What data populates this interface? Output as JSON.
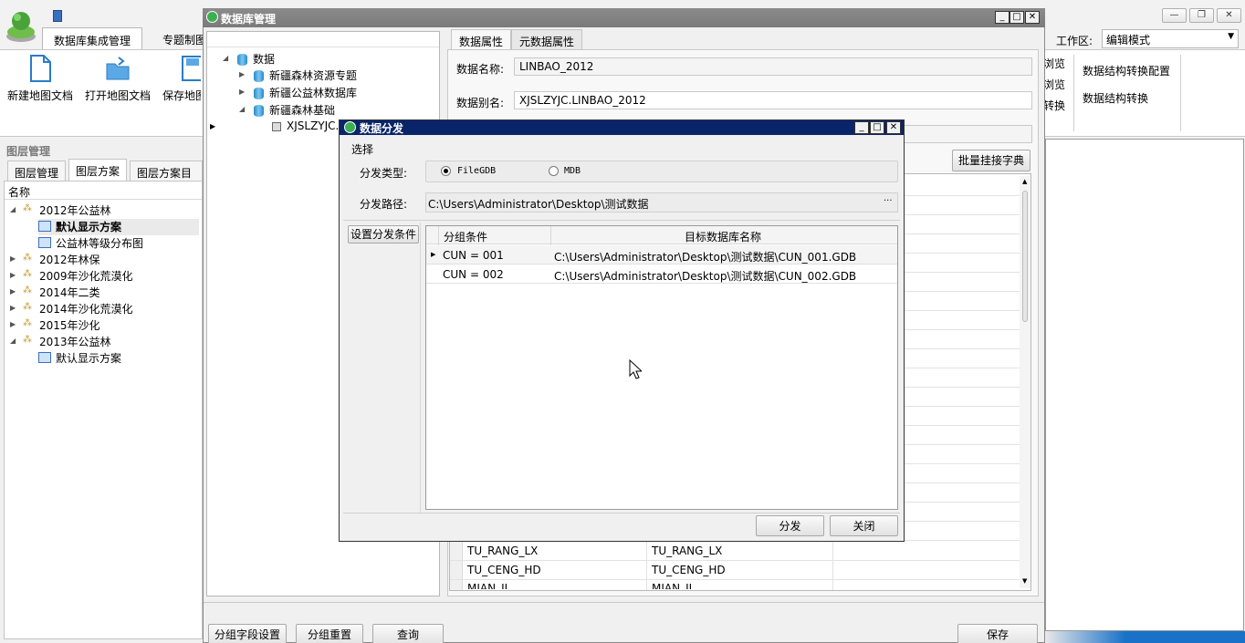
{
  "ribbon": {
    "tabs": [
      "数据库集成管理",
      "专题制图"
    ],
    "buttons": [
      "新建地图文档",
      "打开地图文档",
      "保存地图"
    ],
    "workspace_label": "工作区:",
    "workspace_value": "编辑模式",
    "right_small": [
      "浏览",
      "浏览",
      "转换"
    ],
    "right_buttons": [
      "数据结构转换配置",
      "数据结构转换"
    ]
  },
  "layer_panel": {
    "title": "图层管理",
    "tabs": [
      "图层管理",
      "图层方案",
      "图层方案目录"
    ],
    "column": "名称",
    "items": [
      {
        "label": "2012年公益林",
        "expanded": true,
        "children": [
          "默认显示方案",
          "公益林等级分布图"
        ]
      },
      {
        "label": "2012年林保"
      },
      {
        "label": "2009年沙化荒漠化"
      },
      {
        "label": "2014年二类"
      },
      {
        "label": "2014年沙化荒漠化"
      },
      {
        "label": "2015年沙化"
      },
      {
        "label": "2013年公益林",
        "expanded": true,
        "children": [
          "默认显示方案"
        ]
      }
    ]
  },
  "db_window": {
    "title": "数据库管理",
    "tree": {
      "root": "数据",
      "children": [
        "新疆森林资源专题",
        "新疆公益林数据库",
        "新疆森林基础"
      ],
      "leaf": "XJSLZYJC."
    },
    "tabs": [
      "数据属性",
      "元数据属性"
    ],
    "data_name_label": "数据名称:",
    "data_name_value": "LINBAO_2012",
    "alias_label": "数据别名:",
    "alias_value": "XJSLZYJC.LINBAO_2012",
    "batch_button": "批量挂接字典",
    "grid_rows": [
      [
        "TU_RANG_LX",
        "TU_RANG_LX"
      ],
      [
        "TU_CENG_HD",
        "TU_CENG_HD"
      ],
      [
        "MIAN_JI",
        "MIAN_JI"
      ]
    ],
    "bottom_buttons": [
      "分组字段设置",
      "分组重置",
      "查询"
    ],
    "save_button": "保存"
  },
  "dialog": {
    "title": "数据分发",
    "section": "选择",
    "type_label": "分发类型:",
    "options": [
      "FileGDB",
      "MDB"
    ],
    "selected_option": "FileGDB",
    "path_label": "分发路径:",
    "path_value": "C:\\Users\\Administrator\\Desktop\\测试数据",
    "browse": "···",
    "condition_button": "设置分发条件",
    "columns": [
      "分组条件",
      "目标数据库名称"
    ],
    "rows": [
      {
        "condition": "CUN = 001",
        "target": "C:\\Users\\Administrator\\Desktop\\测试数据\\CUN_001.GDB"
      },
      {
        "condition": "CUN = 002",
        "target": "C:\\Users\\Administrator\\Desktop\\测试数据\\CUN_002.GDB"
      }
    ],
    "ok_button": "分发",
    "close_button": "关闭"
  },
  "colors": {
    "dialog_title": "#0a246a",
    "window_title": "#808080",
    "db_icon": "#2a88c9"
  }
}
